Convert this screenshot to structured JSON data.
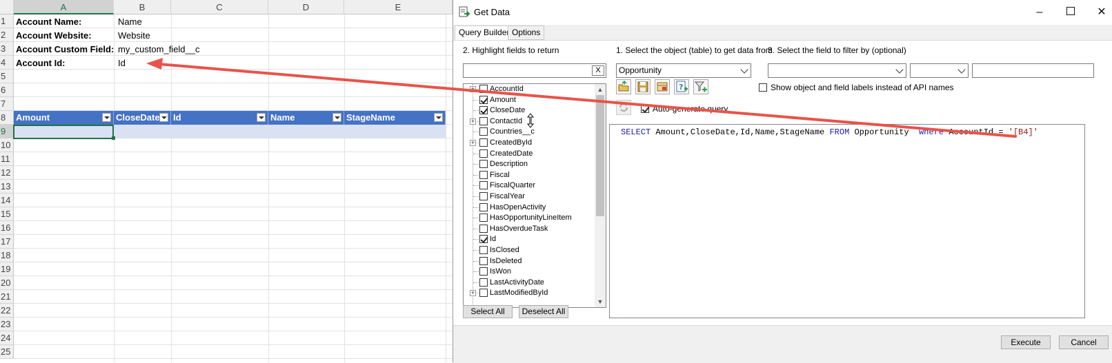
{
  "sheet": {
    "columns": [
      "A",
      "B",
      "C",
      "D",
      "E"
    ],
    "rows": [
      "1",
      "2",
      "3",
      "4",
      "5",
      "6",
      "7",
      "8",
      "9",
      "10",
      "11",
      "12",
      "13",
      "14",
      "15",
      "16",
      "17",
      "18",
      "19",
      "20",
      "21",
      "22",
      "23",
      "24",
      "25"
    ],
    "cells": {
      "a1": "Account Name:",
      "b1": "Name",
      "a2": "Account Website:",
      "b2": "Website",
      "a3": "Account Custom Field:",
      "b3": "my_custom_field__c",
      "a4": "Account Id:",
      "b4": "Id"
    },
    "table_headers": [
      "Amount",
      "CloseDate",
      "Id",
      "Name",
      "StageName"
    ]
  },
  "dialog": {
    "title": "Get Data",
    "tabs": [
      "Query Builder",
      "Options"
    ],
    "highlight_label": "2. Highlight fields to return",
    "search_value": "",
    "clear_label": "X",
    "object_label": "1. Select the object (table) to get data from",
    "object_value": "Opportunity",
    "filter_label": "3. Select the field to filter by (optional)",
    "filter_field_value": "",
    "filter_op_value": "",
    "filter_value": "",
    "show_labels_text": "Show object and field labels instead of API names",
    "autogen_text": "Auto-generate query",
    "fields": [
      {
        "name": "AccountId",
        "checked": false,
        "expandable": true
      },
      {
        "name": "Amount",
        "checked": true,
        "expandable": false
      },
      {
        "name": "CloseDate",
        "checked": true,
        "expandable": false
      },
      {
        "name": "ContactId",
        "checked": false,
        "expandable": true
      },
      {
        "name": "Countries__c",
        "checked": false,
        "expandable": false
      },
      {
        "name": "CreatedById",
        "checked": false,
        "expandable": true
      },
      {
        "name": "CreatedDate",
        "checked": false,
        "expandable": false
      },
      {
        "name": "Description",
        "checked": false,
        "expandable": false
      },
      {
        "name": "Fiscal",
        "checked": false,
        "expandable": false
      },
      {
        "name": "FiscalQuarter",
        "checked": false,
        "expandable": false
      },
      {
        "name": "FiscalYear",
        "checked": false,
        "expandable": false
      },
      {
        "name": "HasOpenActivity",
        "checked": false,
        "expandable": false
      },
      {
        "name": "HasOpportunityLineItem",
        "checked": false,
        "expandable": false
      },
      {
        "name": "HasOverdueTask",
        "checked": false,
        "expandable": false
      },
      {
        "name": "Id",
        "checked": true,
        "expandable": false
      },
      {
        "name": "IsClosed",
        "checked": false,
        "expandable": false
      },
      {
        "name": "IsDeleted",
        "checked": false,
        "expandable": false
      },
      {
        "name": "IsWon",
        "checked": false,
        "expandable": false
      },
      {
        "name": "LastActivityDate",
        "checked": false,
        "expandable": false
      },
      {
        "name": "LastModifiedById",
        "checked": false,
        "expandable": true
      }
    ],
    "select_all": "Select All",
    "deselect_all": "Deselect All",
    "sql_parts": {
      "k1": "SELECT",
      "fields": " Amount,CloseDate,Id,Name,StageName ",
      "k2": "FROM",
      "obj": " Opportunity  ",
      "k3": "where",
      "cond": " AccountId = ",
      "param": "'[B4]'"
    },
    "execute": "Execute",
    "cancel": "Cancel"
  },
  "colors": {
    "accent_green": "#217346",
    "table_header": "#4472c4",
    "arrow": "#e8534a"
  }
}
